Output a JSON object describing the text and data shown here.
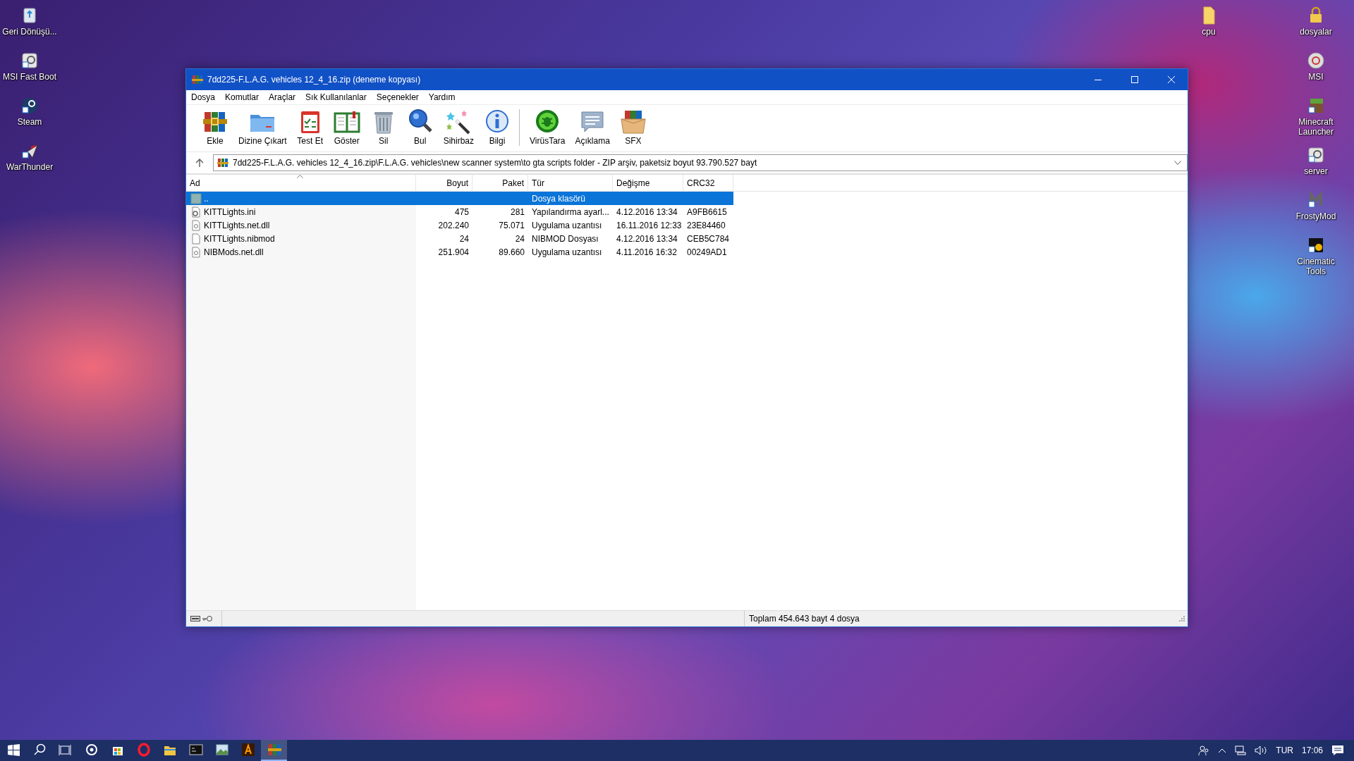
{
  "desktop": {
    "left_icons": [
      {
        "label": "Geri Dönüşü...",
        "kind": "bin"
      },
      {
        "label": "MSI Fast Boot",
        "kind": "app"
      },
      {
        "label": "Steam",
        "kind": "steam"
      },
      {
        "label": "WarThunder",
        "kind": "plane"
      }
    ],
    "right_icons": [
      {
        "label": "cpu",
        "kind": "folder"
      },
      {
        "label": "dosyalar",
        "kind": "lock"
      },
      {
        "label": "MSI",
        "kind": "disc"
      },
      {
        "label": "Minecraft Launcher",
        "kind": "block"
      },
      {
        "label": "server",
        "kind": "app"
      },
      {
        "label": "FrostyMod",
        "kind": "letter"
      },
      {
        "label": "Cinematic Tools",
        "kind": "dark"
      }
    ]
  },
  "window": {
    "title": "7dd225-F.L.A.G. vehicles 12_4_16.zip (deneme kopyası)",
    "menu": [
      "Dosya",
      "Komutlar",
      "Araçlar",
      "Sık Kullanılanlar",
      "Seçenekler",
      "Yardım"
    ],
    "toolbar": [
      {
        "label": "Ekle",
        "kind": "archive"
      },
      {
        "label": "Dizine Çıkart",
        "kind": "folder"
      },
      {
        "label": "Test Et",
        "kind": "test"
      },
      {
        "label": "Göster",
        "kind": "book"
      },
      {
        "label": "Sil",
        "kind": "trash"
      },
      {
        "label": "Bul",
        "kind": "search"
      },
      {
        "label": "Sihirbaz",
        "kind": "wand"
      },
      {
        "label": "Bilgi",
        "kind": "info"
      },
      {
        "label": "VirüsTara",
        "kind": "virus"
      },
      {
        "label": "Açıklama",
        "kind": "comment"
      },
      {
        "label": "SFX",
        "kind": "sfx"
      }
    ],
    "address": "7dd225-F.L.A.G. vehicles 12_4_16.zip\\F.L.A.G. vehicles\\new scanner system\\to gta scripts folder - ZIP arşiv, paketsiz boyut 93.790.527 bayt",
    "columns": [
      "Ad",
      "Boyut",
      "Paket",
      "Tür",
      "Değişme",
      "CRC32"
    ],
    "rows": [
      {
        "name": "..",
        "size": "",
        "packed": "",
        "type": "Dosya klasörü",
        "modified": "",
        "crc": "",
        "kind": "folder",
        "selected": true
      },
      {
        "name": "KITTLights.ini",
        "size": "475",
        "packed": "281",
        "type": "Yapılandırma ayarl...",
        "modified": "4.12.2016 13:34",
        "crc": "A9FB6615",
        "kind": "settings",
        "selected": false
      },
      {
        "name": "KITTLights.net.dll",
        "size": "202.240",
        "packed": "75.071",
        "type": "Uygulama uzantısı",
        "modified": "16.11.2016 12:33",
        "crc": "23E84460",
        "kind": "dll",
        "selected": false
      },
      {
        "name": "KITTLights.nibmod",
        "size": "24",
        "packed": "24",
        "type": "NIBMOD Dosyası",
        "modified": "4.12.2016 13:34",
        "crc": "CEB5C784",
        "kind": "file",
        "selected": false
      },
      {
        "name": "NIBMods.net.dll",
        "size": "251.904",
        "packed": "89.660",
        "type": "Uygulama uzantısı",
        "modified": "4.11.2016 16:32",
        "crc": "00249AD1",
        "kind": "dll",
        "selected": false
      }
    ],
    "status_bar": "Toplam 454.643 bayt 4 dosya"
  },
  "taskbar": {
    "apps": [
      {
        "kind": "start"
      },
      {
        "kind": "search"
      },
      {
        "kind": "taskview"
      },
      {
        "kind": "ring"
      },
      {
        "kind": "store"
      },
      {
        "kind": "opera"
      },
      {
        "kind": "explorer"
      },
      {
        "kind": "console"
      },
      {
        "kind": "picture"
      },
      {
        "kind": "adobe"
      },
      {
        "kind": "archive",
        "selected": true
      }
    ],
    "language": "TUR",
    "time": "17:06"
  }
}
